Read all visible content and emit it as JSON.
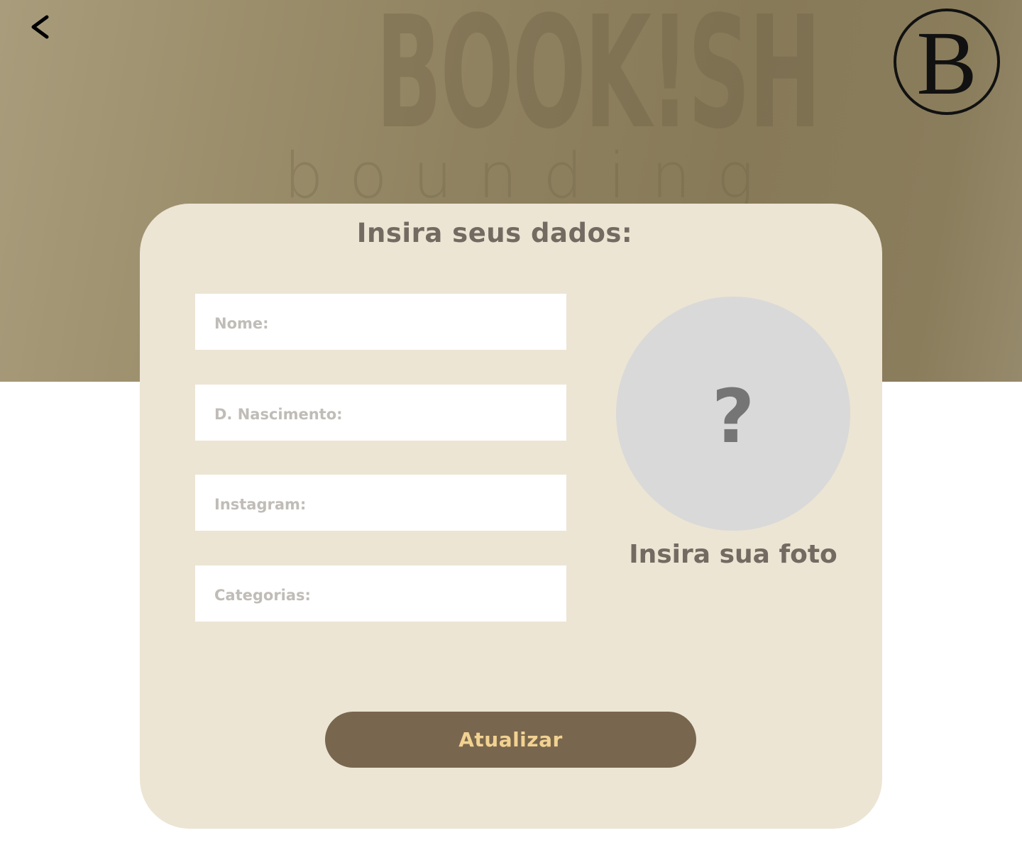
{
  "header": {
    "brand": "BOOK!SH",
    "brand_sub": "bounding",
    "monogram": "B",
    "back_icon": "chevron-left-icon"
  },
  "form": {
    "title": "Insira seus dados:",
    "fields": {
      "nome": {
        "placeholder": "Nome:",
        "value": ""
      },
      "nascimento": {
        "placeholder": "D. Nascimento:",
        "value": ""
      },
      "instagram": {
        "placeholder": "Instagram:",
        "value": ""
      },
      "categorias": {
        "placeholder": "Categorias:",
        "value": ""
      }
    },
    "photo": {
      "symbol": "?",
      "label": "Insira sua foto"
    },
    "submit_label": "Atualizar"
  },
  "colors": {
    "hero": "#8f8260",
    "card": "#ece5d4",
    "button": "#78664f",
    "button_text": "#f2d291",
    "heading_text": "#736b61"
  }
}
